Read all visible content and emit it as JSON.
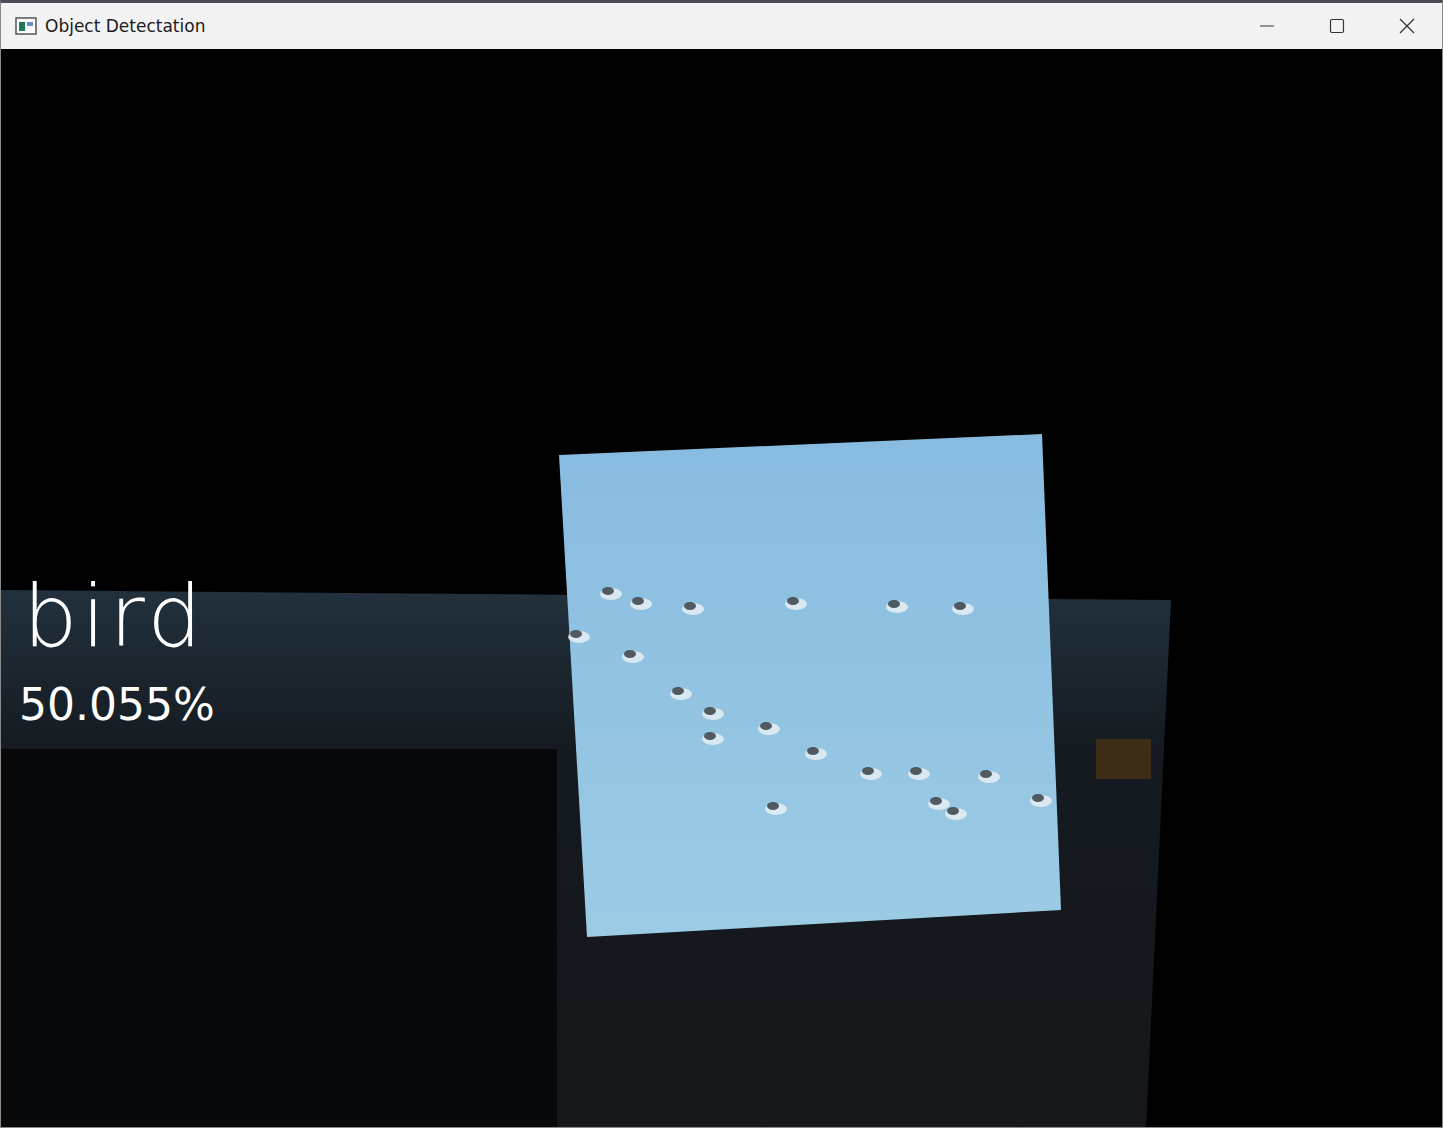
{
  "window": {
    "title": "Object Detectation"
  },
  "detection": {
    "label": "bird",
    "confidence": "50.055%"
  }
}
